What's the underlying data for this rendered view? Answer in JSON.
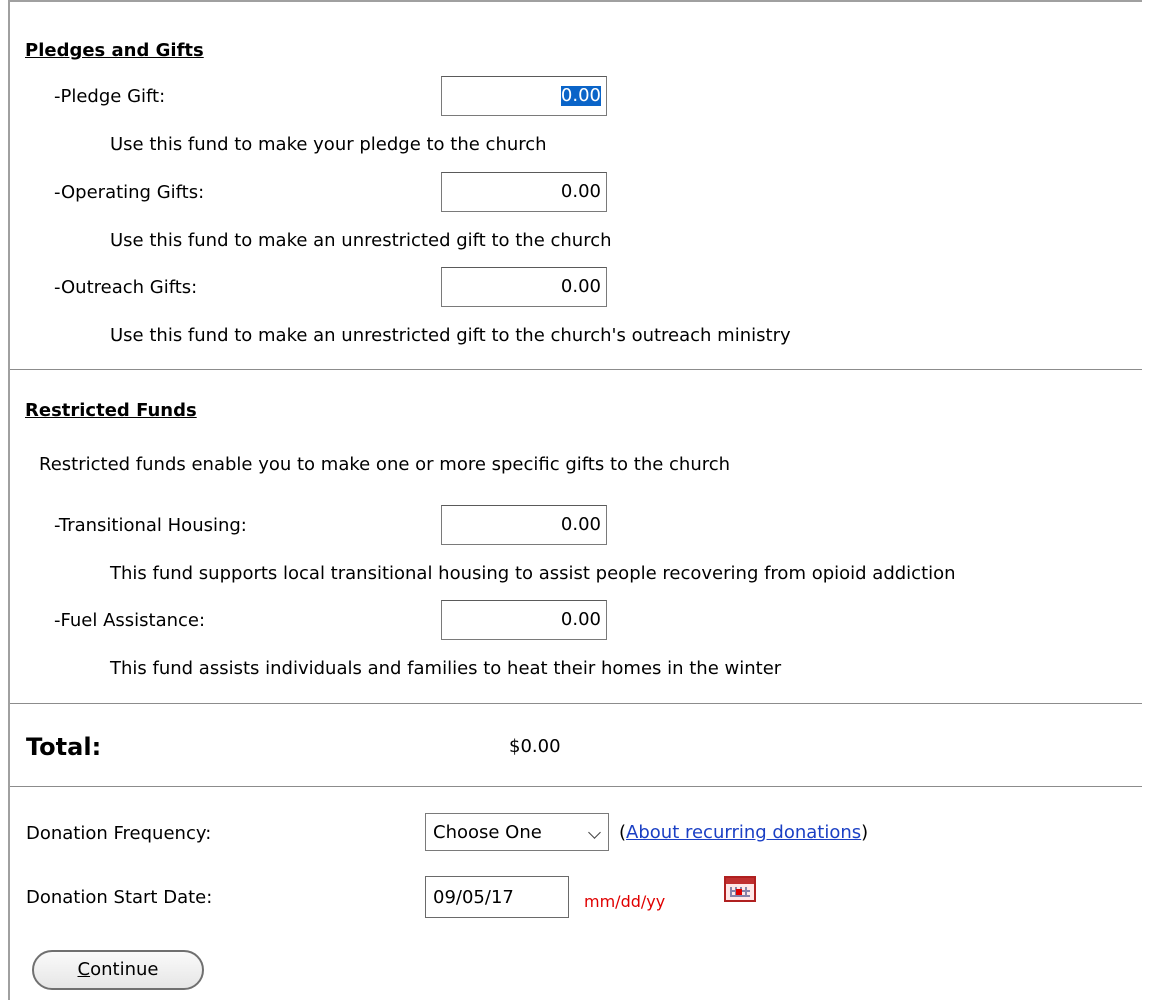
{
  "pledges": {
    "heading": "Pledges and Gifts",
    "items": [
      {
        "label": "-Pledge Gift:",
        "value": "0.00",
        "desc": "Use this fund to make your pledge to the church"
      },
      {
        "label": "-Operating Gifts:",
        "value": "0.00",
        "desc": "Use this fund to make an unrestricted gift to the church"
      },
      {
        "label": "-Outreach Gifts:",
        "value": "0.00",
        "desc": "Use this fund to make an unrestricted gift to the church's outreach ministry"
      }
    ]
  },
  "restricted": {
    "heading": "Restricted Funds",
    "intro": "Restricted funds enable you to make one or more specific gifts to the church",
    "items": [
      {
        "label": "-Transitional Housing:",
        "value": "0.00",
        "desc": "This fund supports local transitional housing to assist people recovering from opioid addiction"
      },
      {
        "label": "-Fuel Assistance:",
        "value": "0.00",
        "desc": "This fund assists individuals and families to heat their homes in the winter"
      }
    ]
  },
  "total": {
    "label": "Total:",
    "value": "$0.00"
  },
  "frequency": {
    "label": "Donation Frequency:",
    "selected": "Choose One",
    "link_open": "(",
    "link_text": "About recurring donations",
    "link_close": ")"
  },
  "start_date": {
    "label": "Donation Start Date:",
    "value": "09/05/17",
    "hint": "mm/dd/yy"
  },
  "continue_button": {
    "first_letter": "C",
    "rest": "ontinue"
  },
  "colors": {
    "link": "#1a3fc4",
    "hint": "#e00000",
    "selection": "#0a64c8"
  }
}
